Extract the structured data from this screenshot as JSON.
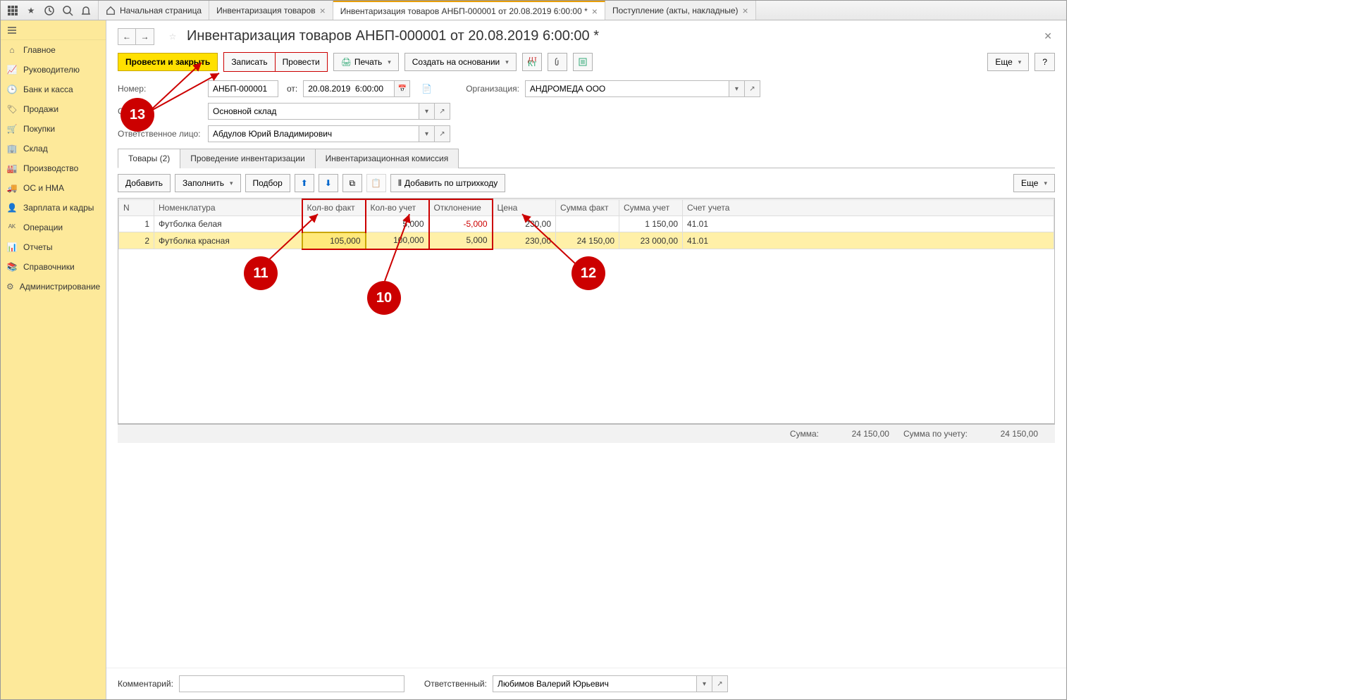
{
  "top_icons": [
    "apps",
    "star",
    "history",
    "search",
    "bell"
  ],
  "tabs": [
    {
      "label": "Начальная страница",
      "home": true,
      "close": false
    },
    {
      "label": "Инвентаризация товаров",
      "close": true
    },
    {
      "label": "Инвентаризация товаров АНБП-000001 от 20.08.2019 6:00:00 *",
      "close": true,
      "active": true
    },
    {
      "label": "Поступление (акты, накладные)",
      "close": true
    }
  ],
  "sidebar": [
    {
      "icon": "home",
      "label": "Главное"
    },
    {
      "icon": "chart",
      "label": "Руководителю"
    },
    {
      "icon": "bank",
      "label": "Банк и касса"
    },
    {
      "icon": "tag",
      "label": "Продажи"
    },
    {
      "icon": "cart",
      "label": "Покупки"
    },
    {
      "icon": "warehouse",
      "label": "Склад"
    },
    {
      "icon": "factory",
      "label": "Производство"
    },
    {
      "icon": "truck",
      "label": "ОС и НМА"
    },
    {
      "icon": "people",
      "label": "Зарплата и кадры"
    },
    {
      "icon": "ops",
      "label": "Операции"
    },
    {
      "icon": "reports",
      "label": "Отчеты"
    },
    {
      "icon": "books",
      "label": "Справочники"
    },
    {
      "icon": "gear",
      "label": "Администрирование"
    }
  ],
  "doc": {
    "title": "Инвентаризация товаров АНБП-000001 от 20.08.2019 6:00:00 *",
    "toolbar": {
      "post_close": "Провести и закрыть",
      "write": "Записать",
      "post": "Провести",
      "print": "Печать",
      "create_based": "Создать на основании",
      "more": "Еще",
      "help": "?"
    },
    "fields": {
      "number_label": "Номер:",
      "number": "АНБП-000001",
      "date_label": "от:",
      "date": "20.08.2019  6:00:00",
      "org_label": "Организация:",
      "org": "АНДРОМЕДА ООО",
      "warehouse_label": "Склад:",
      "warehouse": "Основной склад",
      "resp_person_label": "Ответственное лицо:",
      "resp_person": "Абдулов Юрий Владимирович"
    },
    "sub_tabs": [
      "Товары (2)",
      "Проведение инвентаризации",
      "Инвентаризационная комиссия"
    ],
    "grid_toolbar": {
      "add": "Добавить",
      "fill": "Заполнить",
      "select": "Подбор",
      "barcode": "Добавить по штрихкоду",
      "more": "Еще"
    },
    "columns": [
      "N",
      "Номенклатура",
      "Кол-во факт",
      "Кол-во учет",
      "Отклонение",
      "Цена",
      "Сумма факт",
      "Сумма учет",
      "Счет учета"
    ],
    "rows": [
      {
        "n": "1",
        "name": "Футболка белая",
        "qty_fact": "",
        "qty_acc": "5,000",
        "dev": "-5,000",
        "price": "230,00",
        "sum_fact": "",
        "sum_acc": "1 150,00",
        "account": "41.01"
      },
      {
        "n": "2",
        "name": "Футболка красная",
        "qty_fact": "105,000",
        "qty_acc": "100,000",
        "dev": "5,000",
        "price": "230,00",
        "sum_fact": "24 150,00",
        "sum_acc": "23 000,00",
        "account": "41.01",
        "selected": true
      }
    ],
    "totals": {
      "sum_label": "Сумма:",
      "sum": "24 150,00",
      "sum_acc_label": "Сумма по учету:",
      "sum_acc": "24 150,00"
    },
    "footer": {
      "comment_label": "Комментарий:",
      "comment": "",
      "resp_label": "Ответственный:",
      "resp": "Любимов Валерий Юрьевич"
    }
  },
  "callouts": {
    "10": "10",
    "11": "11",
    "12": "12",
    "13": "13"
  }
}
